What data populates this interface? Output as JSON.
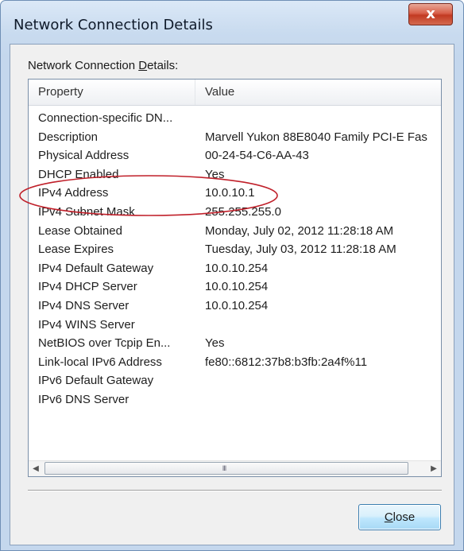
{
  "window": {
    "title": "Network Connection Details",
    "close_glyph": "x"
  },
  "group": {
    "label_prefix": "Network Connection ",
    "label_accel": "D",
    "label_suffix": "etails:"
  },
  "list": {
    "columns": [
      "Property",
      "Value"
    ],
    "rows": [
      {
        "property": "Connection-specific DN...",
        "value": ""
      },
      {
        "property": "Description",
        "value": "Marvell Yukon 88E8040 Family PCI-E Fas"
      },
      {
        "property": "Physical Address",
        "value": "00-24-54-C6-AA-43"
      },
      {
        "property": "DHCP Enabled",
        "value": "Yes"
      },
      {
        "property": "IPv4 Address",
        "value": "10.0.10.1"
      },
      {
        "property": "IPv4 Subnet Mask",
        "value": "255.255.255.0"
      },
      {
        "property": "Lease Obtained",
        "value": "Monday, July 02, 2012 11:28:18 AM"
      },
      {
        "property": "Lease Expires",
        "value": "Tuesday, July 03, 2012 11:28:18 AM"
      },
      {
        "property": "IPv4 Default Gateway",
        "value": "10.0.10.254"
      },
      {
        "property": "IPv4 DHCP Server",
        "value": "10.0.10.254"
      },
      {
        "property": "IPv4 DNS Server",
        "value": "10.0.10.254"
      },
      {
        "property": "IPv4 WINS Server",
        "value": ""
      },
      {
        "property": "NetBIOS over Tcpip En...",
        "value": "Yes"
      },
      {
        "property": "Link-local IPv6 Address",
        "value": "fe80::6812:37b8:b3fb:2a4f%11"
      },
      {
        "property": "IPv6 Default Gateway",
        "value": ""
      },
      {
        "property": "IPv6 DNS Server",
        "value": ""
      }
    ]
  },
  "scrollbar": {
    "left_icon": "scroll-left-icon",
    "right_icon": "scroll-right-icon",
    "grip": "III"
  },
  "buttons": {
    "close_accel": "C",
    "close_rest": "lose"
  },
  "colors": {
    "annotation": "#c0202a",
    "button_border": "#3c7fb1",
    "titlebar_close": "#c23a22"
  }
}
